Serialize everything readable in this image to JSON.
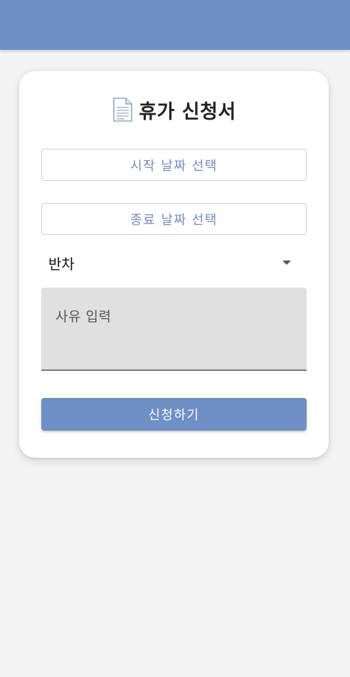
{
  "header": {
    "color": "#6f8fc7"
  },
  "form": {
    "title": "휴가 신청서",
    "title_icon": "document-icon",
    "start_date_label": "시작 날짜 선택",
    "end_date_label": "종료 날짜 선택",
    "type_select": {
      "value": "반차"
    },
    "reason": {
      "placeholder": "사유 입력",
      "value": ""
    },
    "submit_label": "신청하기"
  },
  "colors": {
    "accent": "#6f8fc7",
    "background": "#f4f4f4",
    "card": "#ffffff",
    "textarea_fill": "#e0e0e0"
  }
}
